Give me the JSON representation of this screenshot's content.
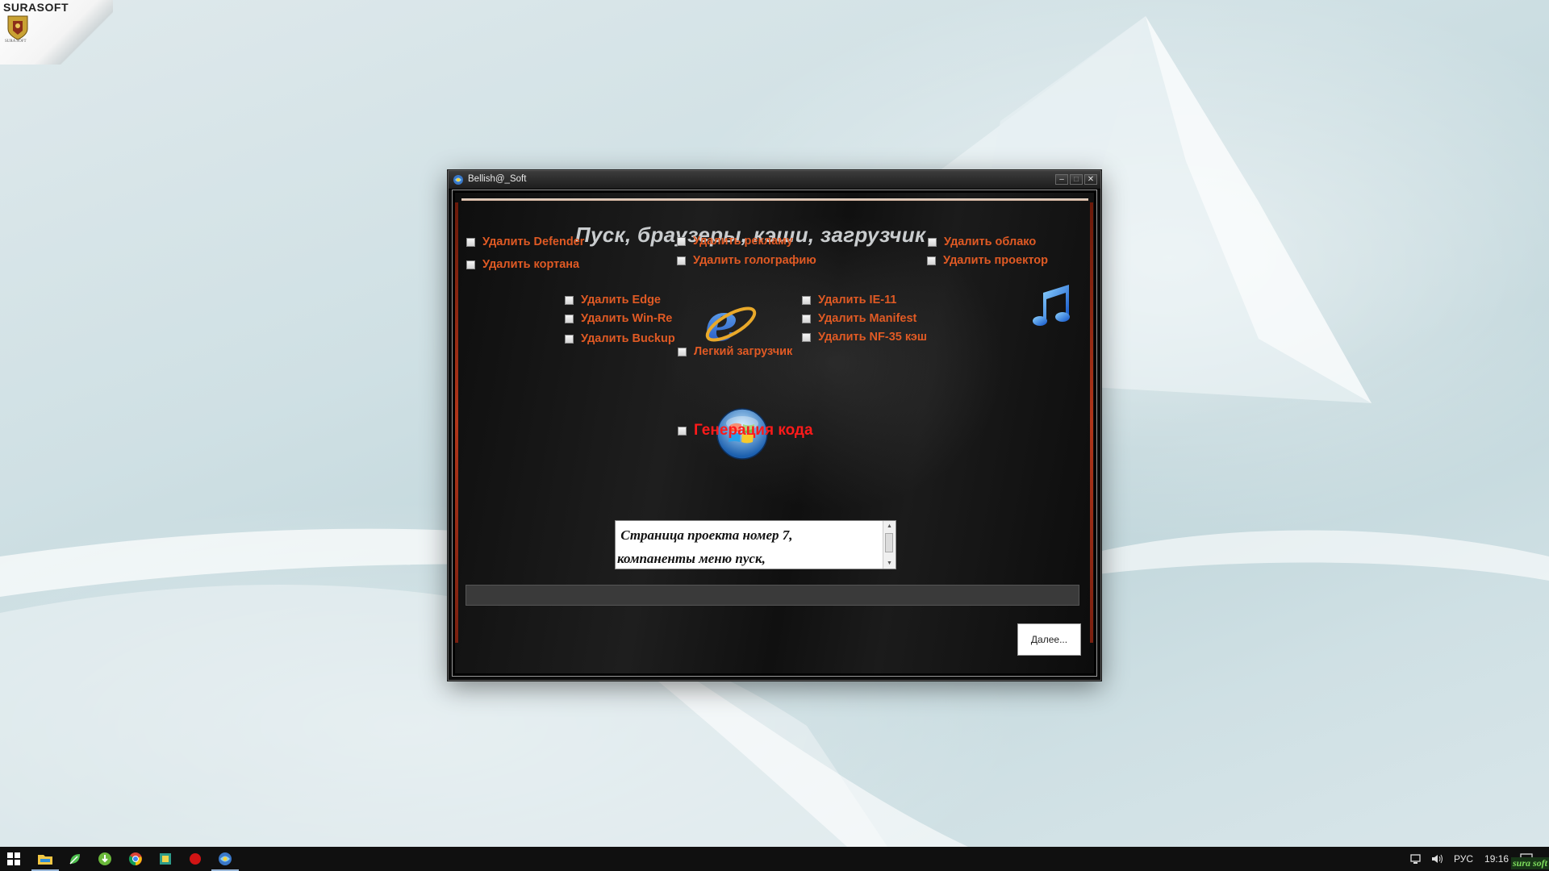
{
  "desktop": {
    "logo_text": "SURASOFT",
    "logo_subtext": "SURA SOFT"
  },
  "window": {
    "title": "Bellish@_Soft",
    "controls": {
      "minimize": "–",
      "maximize": "□",
      "close": "✕"
    },
    "heading": "Пуск, браузеры,  кэши,  загрузчик",
    "options": {
      "defender": "Удалить Defender",
      "cortana": "Удалить кортана",
      "ads": "Удалить рекламу",
      "holography": "Удалить голографию",
      "cloud": "Удалить облако",
      "projector": "Удалить проектор",
      "edge": "Удалить Edge",
      "winre": "Удалить Win-Re",
      "backup": "Удалить Buckup",
      "ie11": "Удалить IE-11",
      "manifest": "Удалить Manifest",
      "nf35": "Удалить NF-35 кэш",
      "loader": "Легкий загрузчик",
      "codegen": "Генерация кода"
    },
    "description": " Страница проекта номер 7,\nкомпаненты меню пуск,",
    "progress": 0,
    "next_button": "Далее..."
  },
  "taskbar": {
    "tray_lang": "РУС",
    "tray_time": "19:16",
    "stamp": "sura soft"
  },
  "colors": {
    "option_text": "#e05a24",
    "codegen_text": "#ff1a1a",
    "heading_text": "#c9ccce"
  }
}
